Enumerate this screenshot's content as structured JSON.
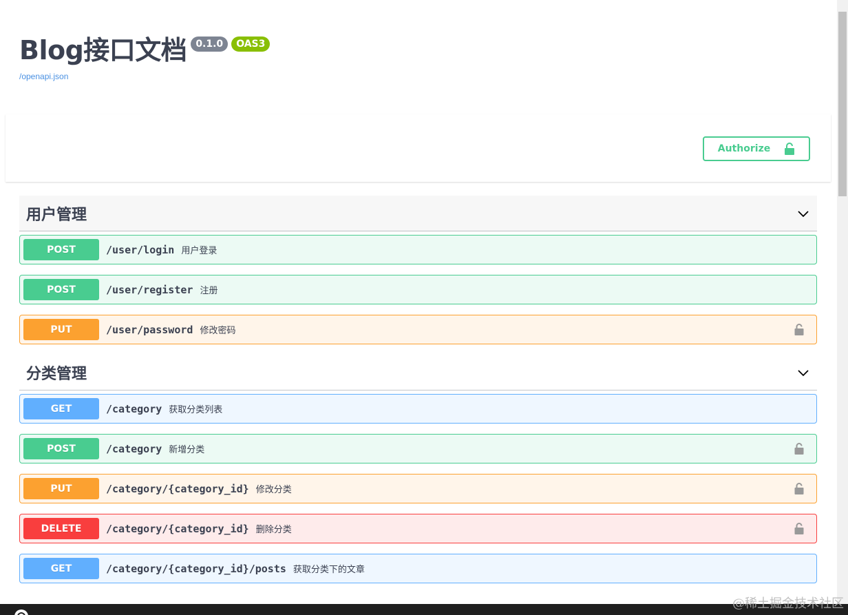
{
  "info": {
    "title": "Blog接口文档",
    "version": "0.1.0",
    "oas": "OAS3",
    "spec_link": "/openapi.json"
  },
  "authorize": {
    "label": "Authorize",
    "icon": "unlocked-padlock-icon"
  },
  "tags": [
    {
      "name": "用户管理",
      "operations": [
        {
          "method": "POST",
          "path": "/user/login",
          "summary": "用户登录",
          "locked": false
        },
        {
          "method": "POST",
          "path": "/user/register",
          "summary": "注册",
          "locked": false
        },
        {
          "method": "PUT",
          "path": "/user/password",
          "summary": "修改密码",
          "locked": true
        }
      ]
    },
    {
      "name": "分类管理",
      "operations": [
        {
          "method": "GET",
          "path": "/category",
          "summary": "获取分类列表",
          "locked": false
        },
        {
          "method": "POST",
          "path": "/category",
          "summary": "新增分类",
          "locked": true
        },
        {
          "method": "PUT",
          "path": "/category/{category_id}",
          "summary": "修改分类",
          "locked": true
        },
        {
          "method": "DELETE",
          "path": "/category/{category_id}",
          "summary": "删除分类",
          "locked": true
        },
        {
          "method": "GET",
          "path": "/category/{category_id}/posts",
          "summary": "获取分类下的文章",
          "locked": false
        }
      ]
    }
  ],
  "colors": {
    "post": "#49cc90",
    "put": "#fca130",
    "get": "#61affe",
    "delete": "#f93e3e",
    "badge_version": "#7d8492",
    "badge_oas": "#89bf04"
  },
  "watermark": "@稀土掘金技术社区"
}
